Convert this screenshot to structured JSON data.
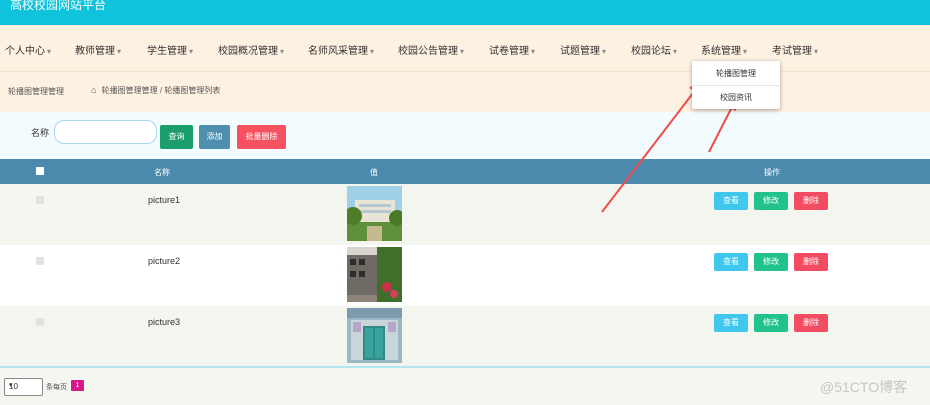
{
  "header": {
    "title": "高校校园网站平台"
  },
  "nav": {
    "items": [
      {
        "label": "个人中心"
      },
      {
        "label": "教师管理"
      },
      {
        "label": "学生管理"
      },
      {
        "label": "校园概况管理"
      },
      {
        "label": "名师风采管理"
      },
      {
        "label": "校园公告管理"
      },
      {
        "label": "试卷管理"
      },
      {
        "label": "试题管理"
      },
      {
        "label": "校园论坛"
      },
      {
        "label": "系统管理"
      },
      {
        "label": "考试管理"
      }
    ],
    "caret": "▾"
  },
  "dropdown": {
    "items": [
      {
        "label": "轮播图管理"
      },
      {
        "label": "校园资讯"
      }
    ]
  },
  "breadcrumb": {
    "left": "轮播图管理管理",
    "home_icon": "⌂",
    "path": "轮播图管理管理 / 轮播图管理列表"
  },
  "search": {
    "label": "名称",
    "value": "",
    "placeholder": ""
  },
  "buttons": {
    "search": "查询",
    "add": "添加",
    "batch_delete": "批量删除"
  },
  "table": {
    "headers": {
      "name": "名称",
      "image": "值",
      "actions": "操作"
    },
    "rows": [
      {
        "name": "picture1",
        "view": "查看",
        "edit": "修改",
        "delete": "删除"
      },
      {
        "name": "picture2",
        "view": "查看",
        "edit": "修改",
        "delete": "删除"
      },
      {
        "name": "picture3",
        "view": "查看",
        "edit": "修改",
        "delete": "删除"
      }
    ]
  },
  "pagination": {
    "page_size": "10",
    "per_page_label": "条每页",
    "current_page": "1"
  },
  "watermark": "@51CTO博客",
  "colors": {
    "topbar": "#0ec3db",
    "table_header": "#4b8aac",
    "view": "#3fc7ee",
    "edit": "#22c28d",
    "delete": "#f24c62",
    "annotation_arrow": "#f04b4b"
  }
}
